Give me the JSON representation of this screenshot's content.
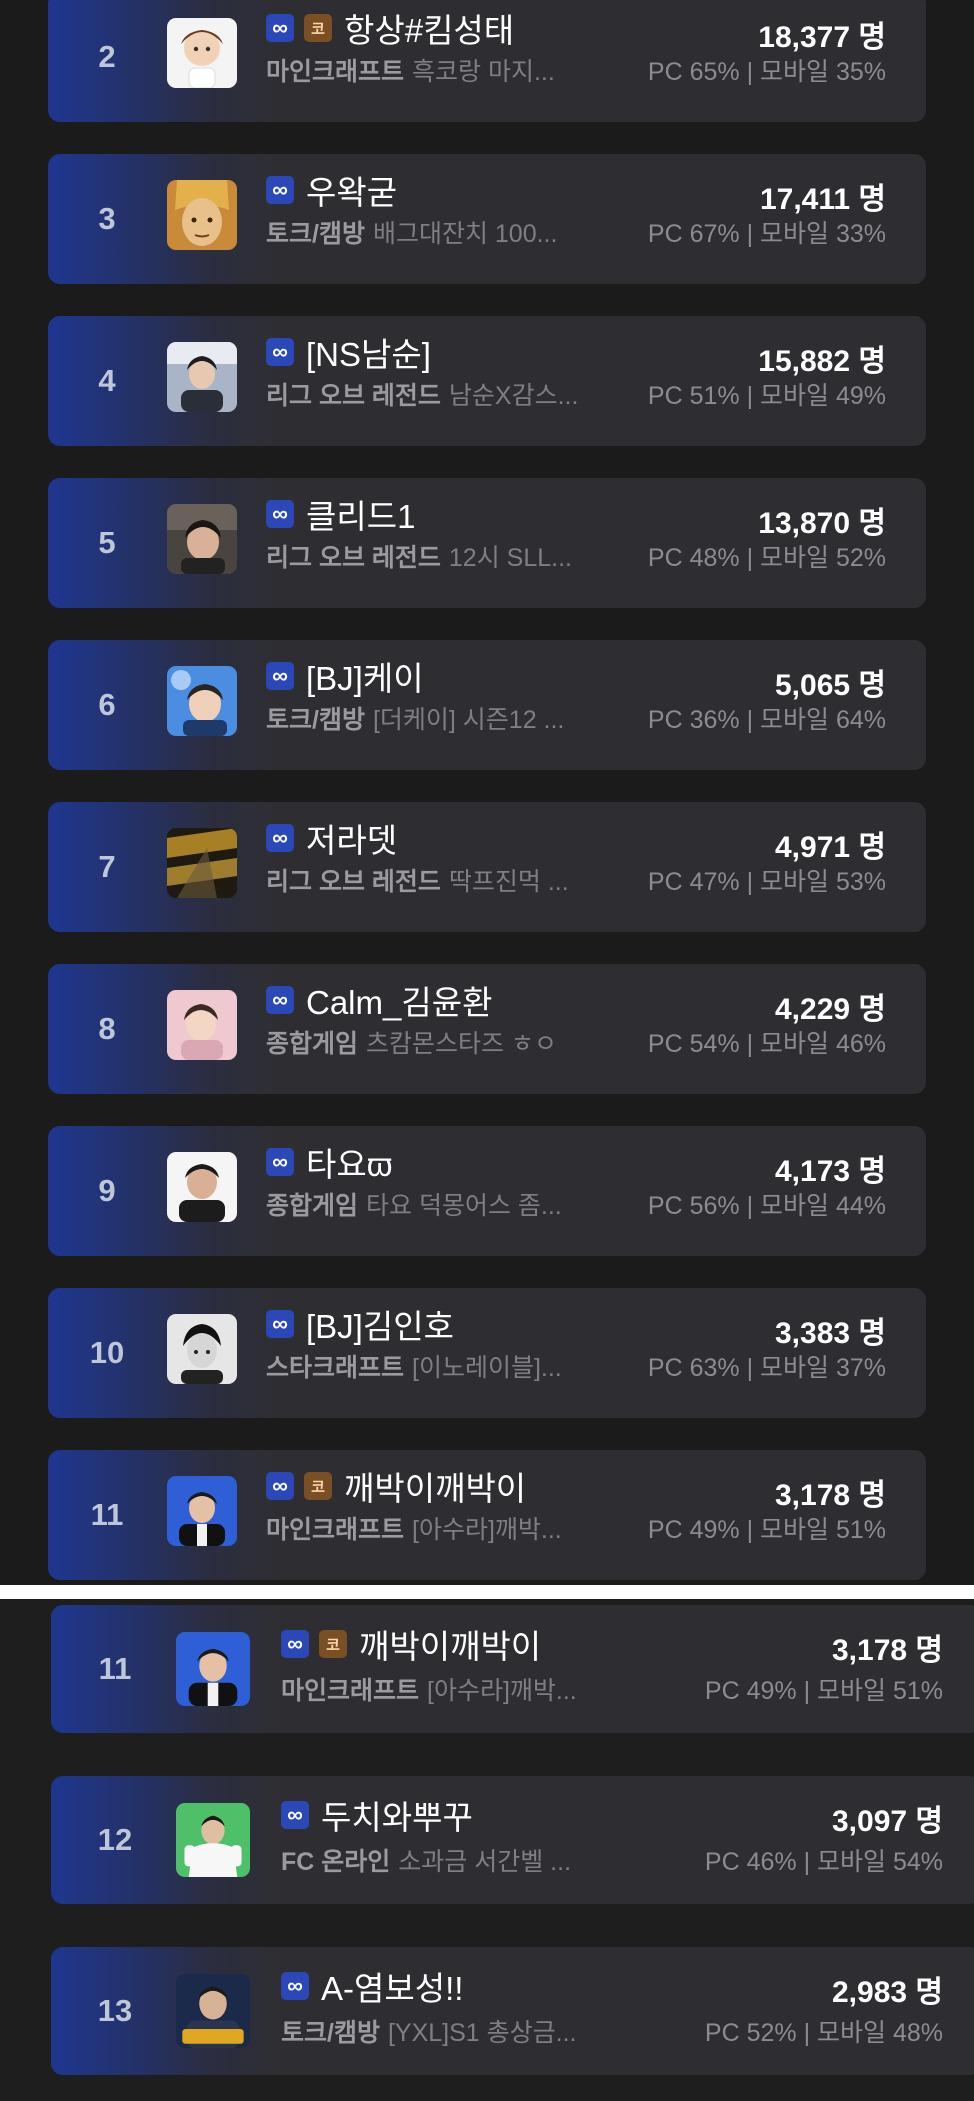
{
  "icons": {
    "infinity": "infinity-badge-icon",
    "subscriber": "subscriber-badge-icon"
  },
  "colors": {
    "accent": "#2c48b8",
    "card": "#2e2e32",
    "bg": "#1b1b1c"
  },
  "list1": [
    {
      "rank": "2",
      "name": "항상#킴성태",
      "category": "마인크래프트",
      "title": "흑코랑 마지...",
      "viewers": "18,377 명",
      "ratio": "PC 65% | 모바일 35%",
      "sub_badge": "코"
    },
    {
      "rank": "3",
      "name": "우왁굳",
      "category": "토크/캠방",
      "title": "배그대잔치 100...",
      "viewers": "17,411 명",
      "ratio": "PC 67% | 모바일 33%"
    },
    {
      "rank": "4",
      "name": "[NS남순]",
      "category": "리그 오브 레전드",
      "title": "남순X감스...",
      "viewers": "15,882 명",
      "ratio": "PC 51% | 모바일 49%"
    },
    {
      "rank": "5",
      "name": "클리드1",
      "category": "리그 오브 레전드",
      "title": "12시 SLL...",
      "viewers": "13,870 명",
      "ratio": "PC 48% | 모바일 52%"
    },
    {
      "rank": "6",
      "name": "[BJ]케이",
      "category": "토크/캠방",
      "title": "[더케이] 시즌12 ...",
      "viewers": "5,065 명",
      "ratio": "PC 36% | 모바일 64%"
    },
    {
      "rank": "7",
      "name": "저라뎃",
      "category": "리그 오브 레전드",
      "title": "딱프진먹 ...",
      "viewers": "4,971 명",
      "ratio": "PC 47% | 모바일 53%"
    },
    {
      "rank": "8",
      "name": "Calm_김윤환",
      "category": "종합게임",
      "title": "츠캄몬스타즈 ㅎㅇ",
      "viewers": "4,229 명",
      "ratio": "PC 54% | 모바일 46%"
    },
    {
      "rank": "9",
      "name": "타요ϖ",
      "category": "종합게임",
      "title": "타요 덕몽어스 좀...",
      "viewers": "4,173 명",
      "ratio": "PC 56% | 모바일 44%"
    },
    {
      "rank": "10",
      "name": "[BJ]김인호",
      "category": "스타크래프트",
      "title": "[이노레이블]...",
      "viewers": "3,383 명",
      "ratio": "PC 63% | 모바일 37%"
    },
    {
      "rank": "11",
      "name": "깨박이깨박이",
      "category": "마인크래프트",
      "title": "[아수라]깨박...",
      "viewers": "3,178 명",
      "ratio": "PC 49% | 모바일 51%",
      "sub_badge": "코"
    }
  ],
  "list2": [
    {
      "rank": "11",
      "name": "깨박이깨박이",
      "category": "마인크래프트",
      "title": "[아수라]깨박...",
      "viewers": "3,178 명",
      "ratio": "PC 49% | 모바일 51%",
      "sub_badge": "코"
    },
    {
      "rank": "12",
      "name": "두치와뿌꾸",
      "category": "FC 온라인",
      "title": "소과금 서간벨 ...",
      "viewers": "3,097 명",
      "ratio": "PC 46% | 모바일 54%"
    },
    {
      "rank": "13",
      "name": "A-염보성!!",
      "category": "토크/캠방",
      "title": "[YXL]S1 총상금...",
      "viewers": "2,983 명",
      "ratio": "PC 52% | 모바일 48%"
    }
  ]
}
